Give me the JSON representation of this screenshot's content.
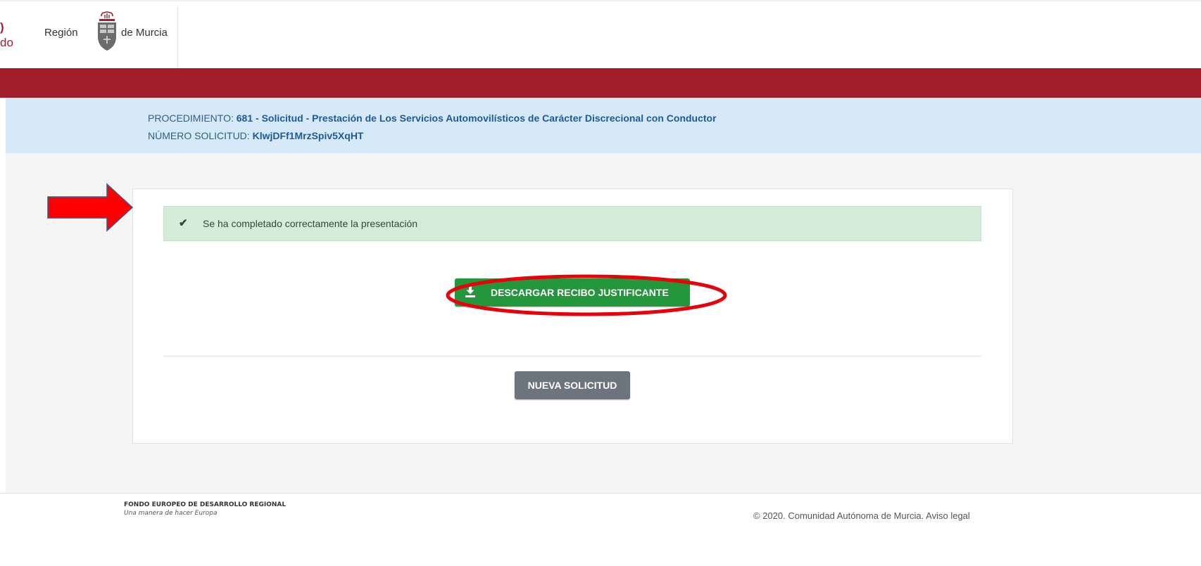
{
  "header": {
    "left_fragment_top": ")",
    "left_fragment_bottom": "do",
    "brand_left": "Región",
    "brand_right": "de Murcia",
    "brand_color": "#a31e2d"
  },
  "info": {
    "procedure_label": "PROCEDIMIENTO:",
    "procedure_value": "681 - Solicitud - Prestación de Los Servicios Automovilísticos de Carácter Discrecional con Conductor",
    "request_label": "NÚMERO SOLICITUD:",
    "request_value": "KlwjDFf1MrzSpiv5XqHT"
  },
  "alert": {
    "icon": "check-icon",
    "message": "Se ha completado correctamente la presentación"
  },
  "actions": {
    "download_label": "DESCARGAR RECIBO JUSTIFICANTE",
    "download_icon": "download-icon",
    "new_request_label": "NUEVA SOLICITUD"
  },
  "annotations": {
    "arrow_color": "#ff0000",
    "ellipse_color": "#e8000b"
  },
  "footer": {
    "fund": "FONDO EUROPEO DE DESARROLLO REGIONAL",
    "motto": "Una manera de hacer Europa",
    "copyright": "© 2020. Comunidad Autónoma de Murcia. Aviso legal"
  }
}
